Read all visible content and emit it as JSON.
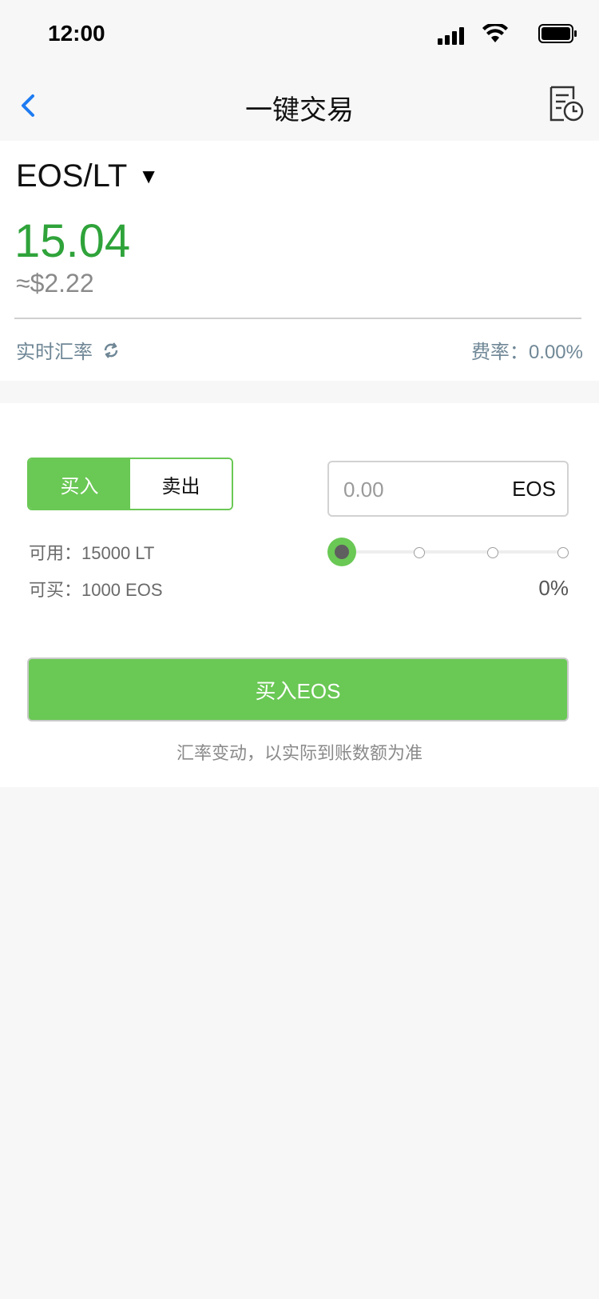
{
  "status_bar": {
    "time": "12:00"
  },
  "nav": {
    "title": "一键交易",
    "back_icon": "chevron-left-icon",
    "history_icon": "history-record-icon"
  },
  "pair": {
    "name": "EOS/LT",
    "caret": "▼",
    "price": "15.04",
    "usd_equivalent": "≈$2.22",
    "realtime_rate_label": "实时汇率",
    "fee_label": "费率：",
    "fee_value": "0.00%"
  },
  "trade": {
    "buy_tab": "买入",
    "sell_tab": "卖出",
    "available": "可用：15000 LT",
    "buyable": "可买：1000 EOS",
    "amount_placeholder": "0.00",
    "amount_unit": "EOS",
    "slider_percent": "0%",
    "slider_value": 0,
    "buy_button": "买入EOS",
    "notice": "汇率变动，以实际到账数额为准"
  },
  "colors": {
    "accent_green": "#6ac855",
    "price_green": "#2fa33a",
    "link_blue": "#1e7cf2"
  }
}
